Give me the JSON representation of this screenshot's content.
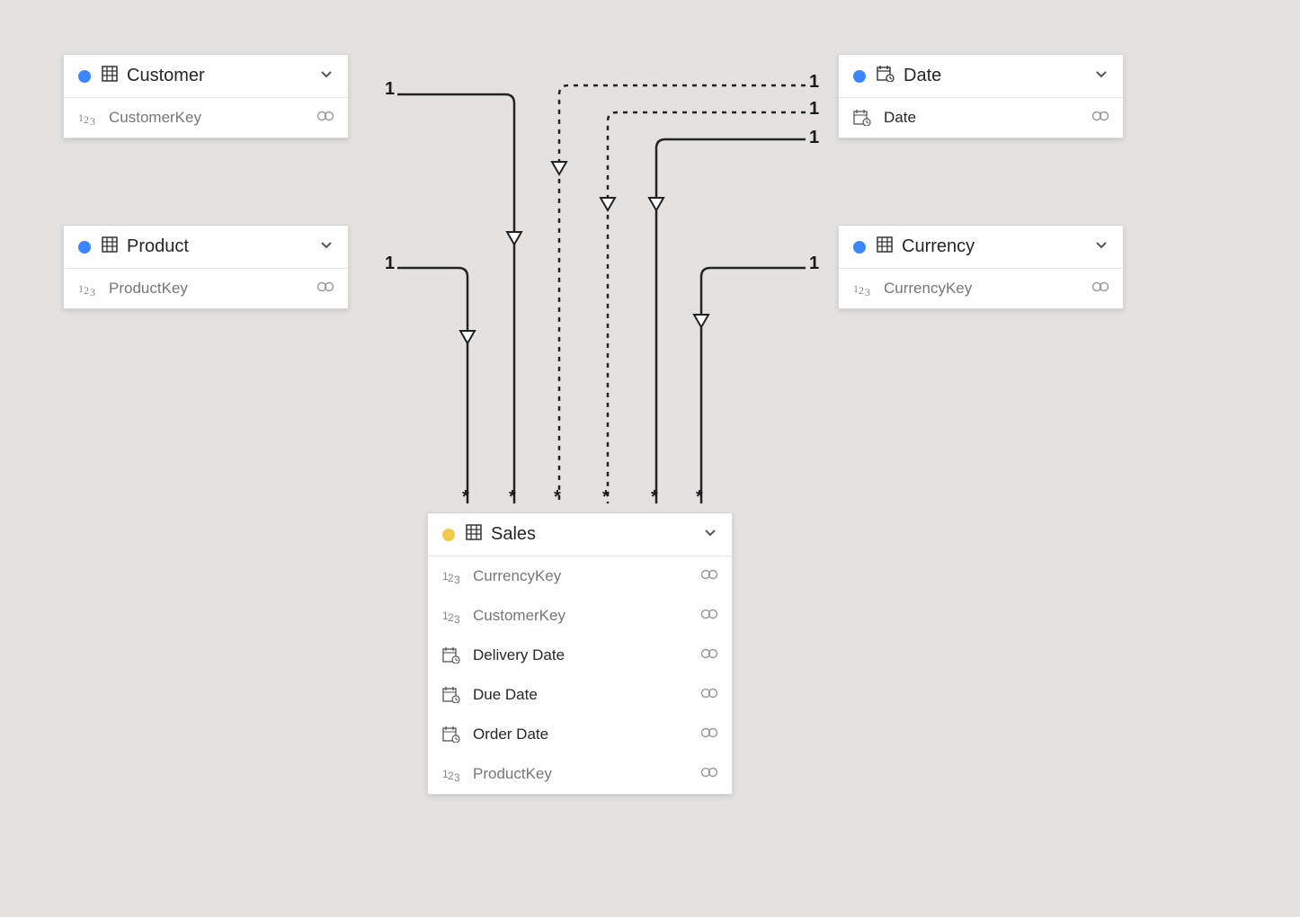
{
  "tables": {
    "customer": {
      "title": "Customer",
      "dot": "blue",
      "columns": [
        {
          "icon": "number",
          "name": "CustomerKey",
          "muted": true
        }
      ]
    },
    "product": {
      "title": "Product",
      "dot": "blue",
      "columns": [
        {
          "icon": "number",
          "name": "ProductKey",
          "muted": true
        }
      ]
    },
    "date": {
      "title": "Date",
      "dot": "blue",
      "header_icon": "date-table",
      "columns": [
        {
          "icon": "date",
          "name": "Date",
          "muted": false
        }
      ]
    },
    "currency": {
      "title": "Currency",
      "dot": "blue",
      "columns": [
        {
          "icon": "number",
          "name": "CurrencyKey",
          "muted": true
        }
      ]
    },
    "sales": {
      "title": "Sales",
      "dot": "yellow",
      "columns": [
        {
          "icon": "number",
          "name": "CurrencyKey",
          "muted": true
        },
        {
          "icon": "number",
          "name": "CustomerKey",
          "muted": true
        },
        {
          "icon": "date",
          "name": "Delivery Date",
          "muted": false
        },
        {
          "icon": "date",
          "name": "Due Date",
          "muted": false
        },
        {
          "icon": "date",
          "name": "Order Date",
          "muted": false
        },
        {
          "icon": "number",
          "name": "ProductKey",
          "muted": true
        }
      ]
    }
  },
  "relationship_labels": {
    "customer_source": "1",
    "product_source": "1",
    "date_source_1": "1",
    "date_source_2": "1",
    "date_source_3": "1",
    "currency_source": "1",
    "sales_target_1": "*",
    "sales_target_2": "*",
    "sales_target_3": "*",
    "sales_target_4": "*",
    "sales_target_5": "*",
    "sales_target_6": "*"
  },
  "relationships": [
    {
      "from": "Customer",
      "to": "Sales",
      "from_card": "1",
      "to_card": "*",
      "active": true
    },
    {
      "from": "Product",
      "to": "Sales",
      "from_card": "1",
      "to_card": "*",
      "active": true
    },
    {
      "from": "Date",
      "to": "Sales",
      "from_card": "1",
      "to_card": "*",
      "active": true
    },
    {
      "from": "Date",
      "to": "Sales",
      "from_card": "1",
      "to_card": "*",
      "active": false
    },
    {
      "from": "Date",
      "to": "Sales",
      "from_card": "1",
      "to_card": "*",
      "active": false
    },
    {
      "from": "Currency",
      "to": "Sales",
      "from_card": "1",
      "to_card": "*",
      "active": true
    }
  ]
}
